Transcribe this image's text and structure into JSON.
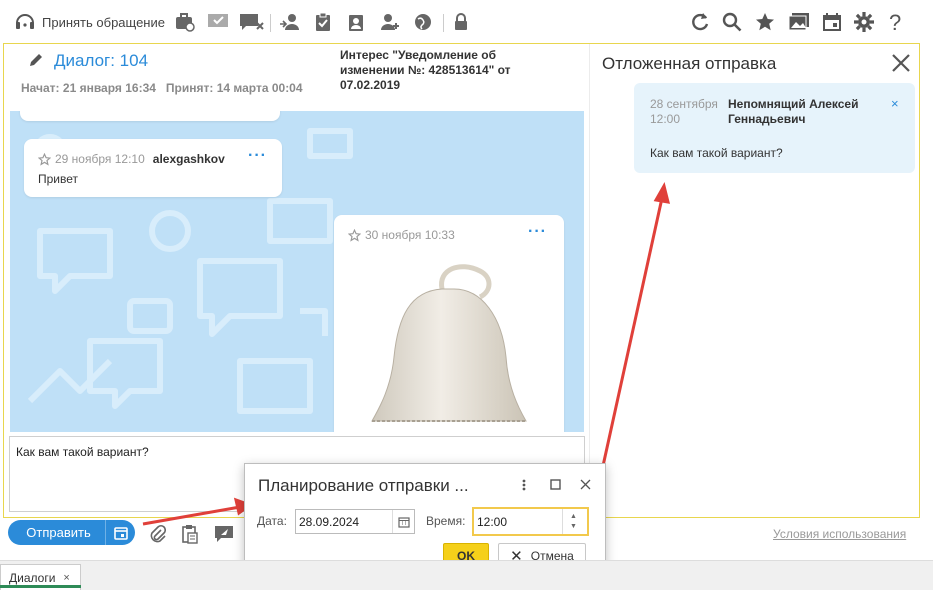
{
  "toolbar": {
    "accept_label": "Принять обращение"
  },
  "dialog": {
    "title": "Диалог: 104",
    "started": "Начат: 21 января 16:34",
    "accepted": "Принят: 14 марта 00:04",
    "interest": "Интерес \"Уведомление об изменении №: 428513614\" от 07.02.2019"
  },
  "messages": [
    {
      "date": "29 ноября 12:10",
      "author": "alexgashkov",
      "text": "Привет",
      "menu": "···"
    },
    {
      "date": "30 ноября 10:33",
      "menu": "···"
    }
  ],
  "compose": {
    "text": "Как вам такой вариант?"
  },
  "send": {
    "label": "Отправить"
  },
  "terms_link": "Условия использования",
  "side_panel": {
    "title": "Отложенная отправка",
    "card": {
      "date": "28 сентября 12:00",
      "author": "Непомнящий Алексей Геннадьевич",
      "text": "Как вам такой вариант?",
      "remove": "×"
    }
  },
  "modal": {
    "title": "Планирование отправки ...",
    "date_label": "Дата:",
    "date_value": "28.09.2024",
    "time_label": "Время:",
    "time_value": "12:00",
    "ok_label": "OK",
    "cancel_label": "Отмена"
  },
  "tabs": {
    "dialogs_label": "Диалоги",
    "close": "×"
  },
  "colors": {
    "accent": "#2b8bd9",
    "frame_border": "#e8d64e",
    "ok_button": "#f5d01a",
    "chat_bg": "#bfe0f7",
    "scheduled_card": "#e6f3fb",
    "arrow": "#e0403a"
  }
}
